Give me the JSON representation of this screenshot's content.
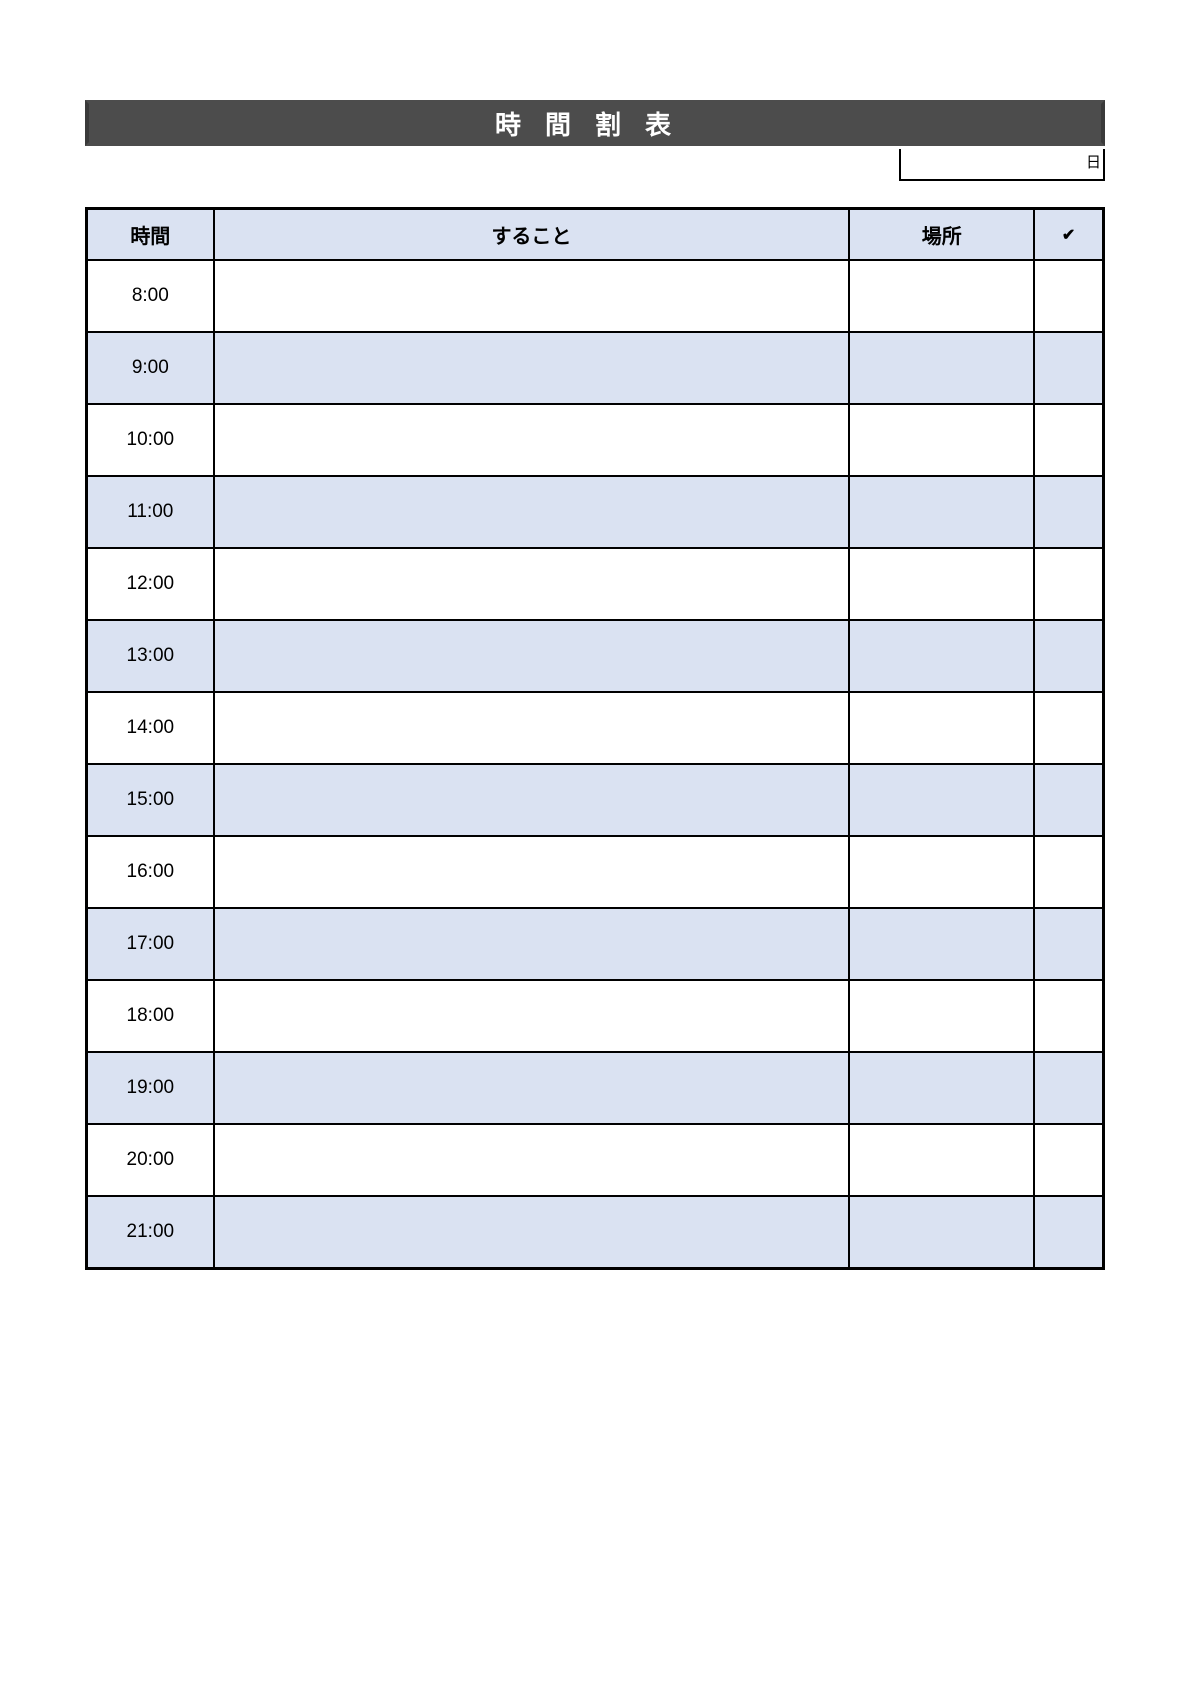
{
  "title": "時間割表",
  "date_suffix": "日",
  "headers": {
    "time": "時間",
    "task": "すること",
    "place": "場所",
    "check": "✔"
  },
  "rows": [
    {
      "time": "8:00",
      "task": "",
      "place": "",
      "check": ""
    },
    {
      "time": "9:00",
      "task": "",
      "place": "",
      "check": ""
    },
    {
      "time": "10:00",
      "task": "",
      "place": "",
      "check": ""
    },
    {
      "time": "11:00",
      "task": "",
      "place": "",
      "check": ""
    },
    {
      "time": "12:00",
      "task": "",
      "place": "",
      "check": ""
    },
    {
      "time": "13:00",
      "task": "",
      "place": "",
      "check": ""
    },
    {
      "time": "14:00",
      "task": "",
      "place": "",
      "check": ""
    },
    {
      "time": "15:00",
      "task": "",
      "place": "",
      "check": ""
    },
    {
      "time": "16:00",
      "task": "",
      "place": "",
      "check": ""
    },
    {
      "time": "17:00",
      "task": "",
      "place": "",
      "check": ""
    },
    {
      "time": "18:00",
      "task": "",
      "place": "",
      "check": ""
    },
    {
      "time": "19:00",
      "task": "",
      "place": "",
      "check": ""
    },
    {
      "time": "20:00",
      "task": "",
      "place": "",
      "check": ""
    },
    {
      "time": "21:00",
      "task": "",
      "place": "",
      "check": ""
    }
  ]
}
